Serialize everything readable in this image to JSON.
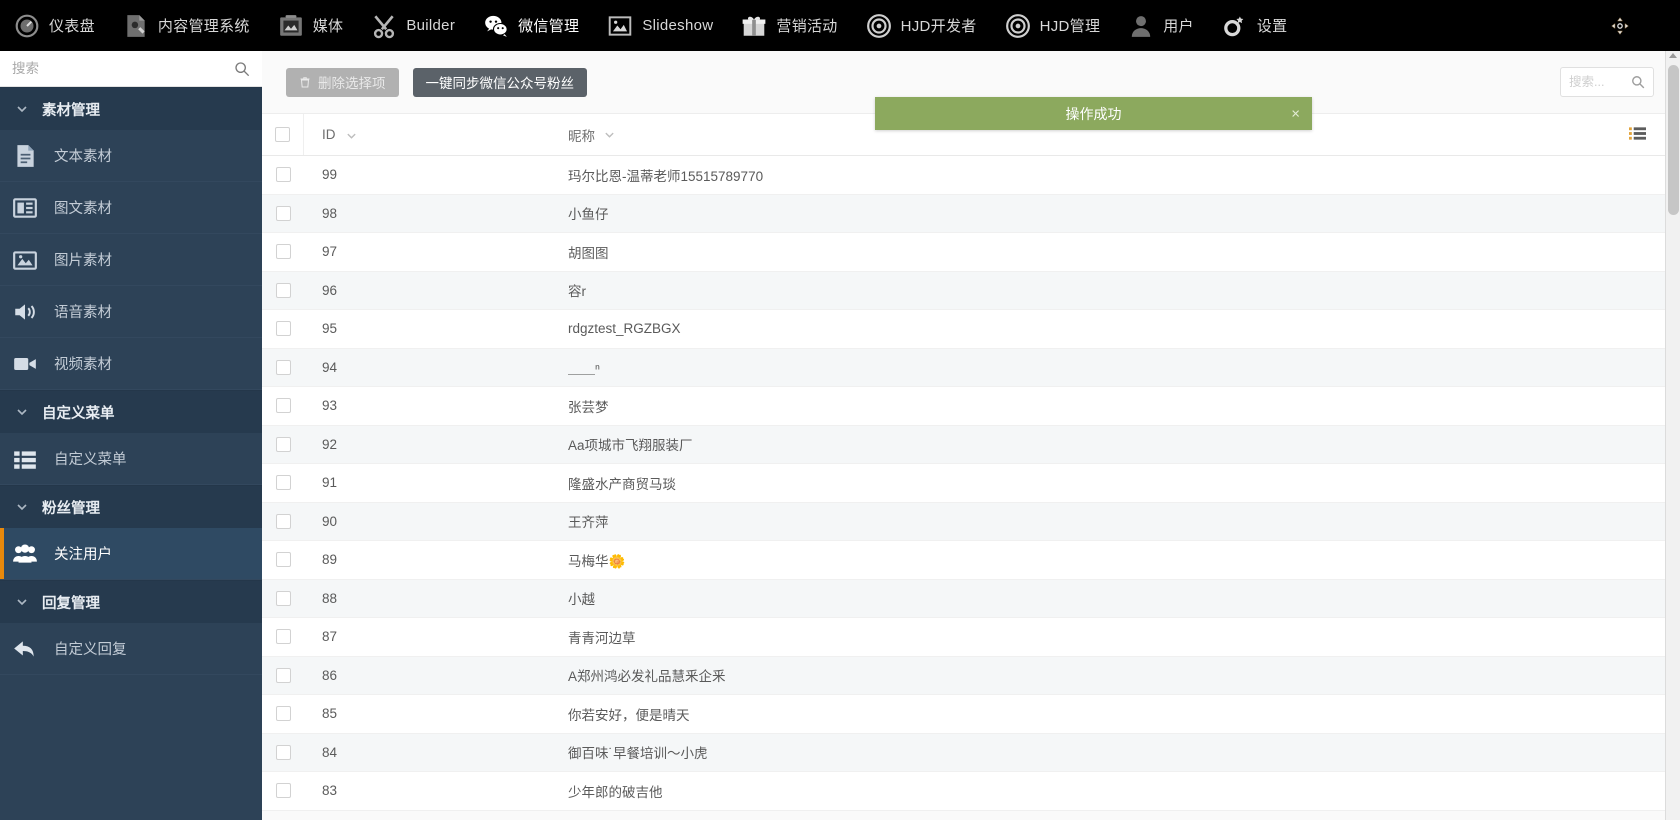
{
  "topbar": {
    "items": [
      {
        "label": "仪表盘",
        "icon": "dashboard-icon"
      },
      {
        "label": "内容管理系统",
        "icon": "cms-icon"
      },
      {
        "label": "媒体",
        "icon": "media-icon"
      },
      {
        "label": "Builder",
        "icon": "builder-icon"
      },
      {
        "label": "微信管理",
        "icon": "wechat-icon"
      },
      {
        "label": "Slideshow",
        "icon": "slideshow-icon"
      },
      {
        "label": "营销活动",
        "icon": "gift-icon"
      },
      {
        "label": "HJD开发者",
        "icon": "target-icon"
      },
      {
        "label": "HJD管理",
        "icon": "target-icon"
      },
      {
        "label": "用户",
        "icon": "user-icon"
      },
      {
        "label": "设置",
        "icon": "gear-icon"
      }
    ],
    "active_index": 4,
    "right_icon": "move-crosshair-icon"
  },
  "sidebar": {
    "search_placeholder": "搜索",
    "search_value": "",
    "blocks": [
      {
        "group": "素材管理",
        "items": [
          {
            "label": "文本素材",
            "icon": "document-icon"
          },
          {
            "label": "图文素材",
            "icon": "news-icon"
          },
          {
            "label": "图片素材",
            "icon": "image-icon"
          },
          {
            "label": "语音素材",
            "icon": "audio-icon"
          },
          {
            "label": "视频素材",
            "icon": "video-icon"
          }
        ]
      },
      {
        "group": "自定义菜单",
        "items": [
          {
            "label": "自定义菜单",
            "icon": "list-icon"
          }
        ]
      },
      {
        "group": "粉丝管理",
        "items": [
          {
            "label": "关注用户",
            "icon": "users-icon",
            "selected": true
          }
        ]
      },
      {
        "group": "回复管理",
        "items": [
          {
            "label": "自定义回复",
            "icon": "reply-arrow-icon"
          }
        ]
      }
    ]
  },
  "toolbar": {
    "delete_label": "删除选择项",
    "sync_label": "一键同步微信公众号粉丝",
    "search_placeholder": "搜索...",
    "search_value": ""
  },
  "toast": {
    "message": "操作成功",
    "close_label": "×",
    "color": "#8ca95e"
  },
  "table": {
    "columns": [
      {
        "key": "id",
        "label": "ID"
      },
      {
        "key": "name",
        "label": "昵称"
      }
    ],
    "rows": [
      {
        "id": "99",
        "name": "玛尔比恩-温蒂老师15515789770"
      },
      {
        "id": "98",
        "name": "小鱼仔"
      },
      {
        "id": "97",
        "name": "胡图图"
      },
      {
        "id": "96",
        "name": "容r"
      },
      {
        "id": "95",
        "name": "rdgztest_RGZBGX"
      },
      {
        "id": "94",
        "name": "＿＿ⁿ"
      },
      {
        "id": "93",
        "name": "张芸梦"
      },
      {
        "id": "92",
        "name": "Aa项城市飞翔服装厂"
      },
      {
        "id": "91",
        "name": "隆盛水产商贸马琰"
      },
      {
        "id": "90",
        "name": "王齐萍"
      },
      {
        "id": "89",
        "name": "马梅华🌼"
      },
      {
        "id": "88",
        "name": "小越"
      },
      {
        "id": "87",
        "name": "青青河边草"
      },
      {
        "id": "86",
        "name": "A郑州鸿必发礼品慧釆企釆"
      },
      {
        "id": "85",
        "name": "你若安好，便是晴天"
      },
      {
        "id": "84",
        "name": "御百味˙早餐培训～小虎"
      },
      {
        "id": "83",
        "name": "少年郎的破吉他"
      }
    ]
  }
}
